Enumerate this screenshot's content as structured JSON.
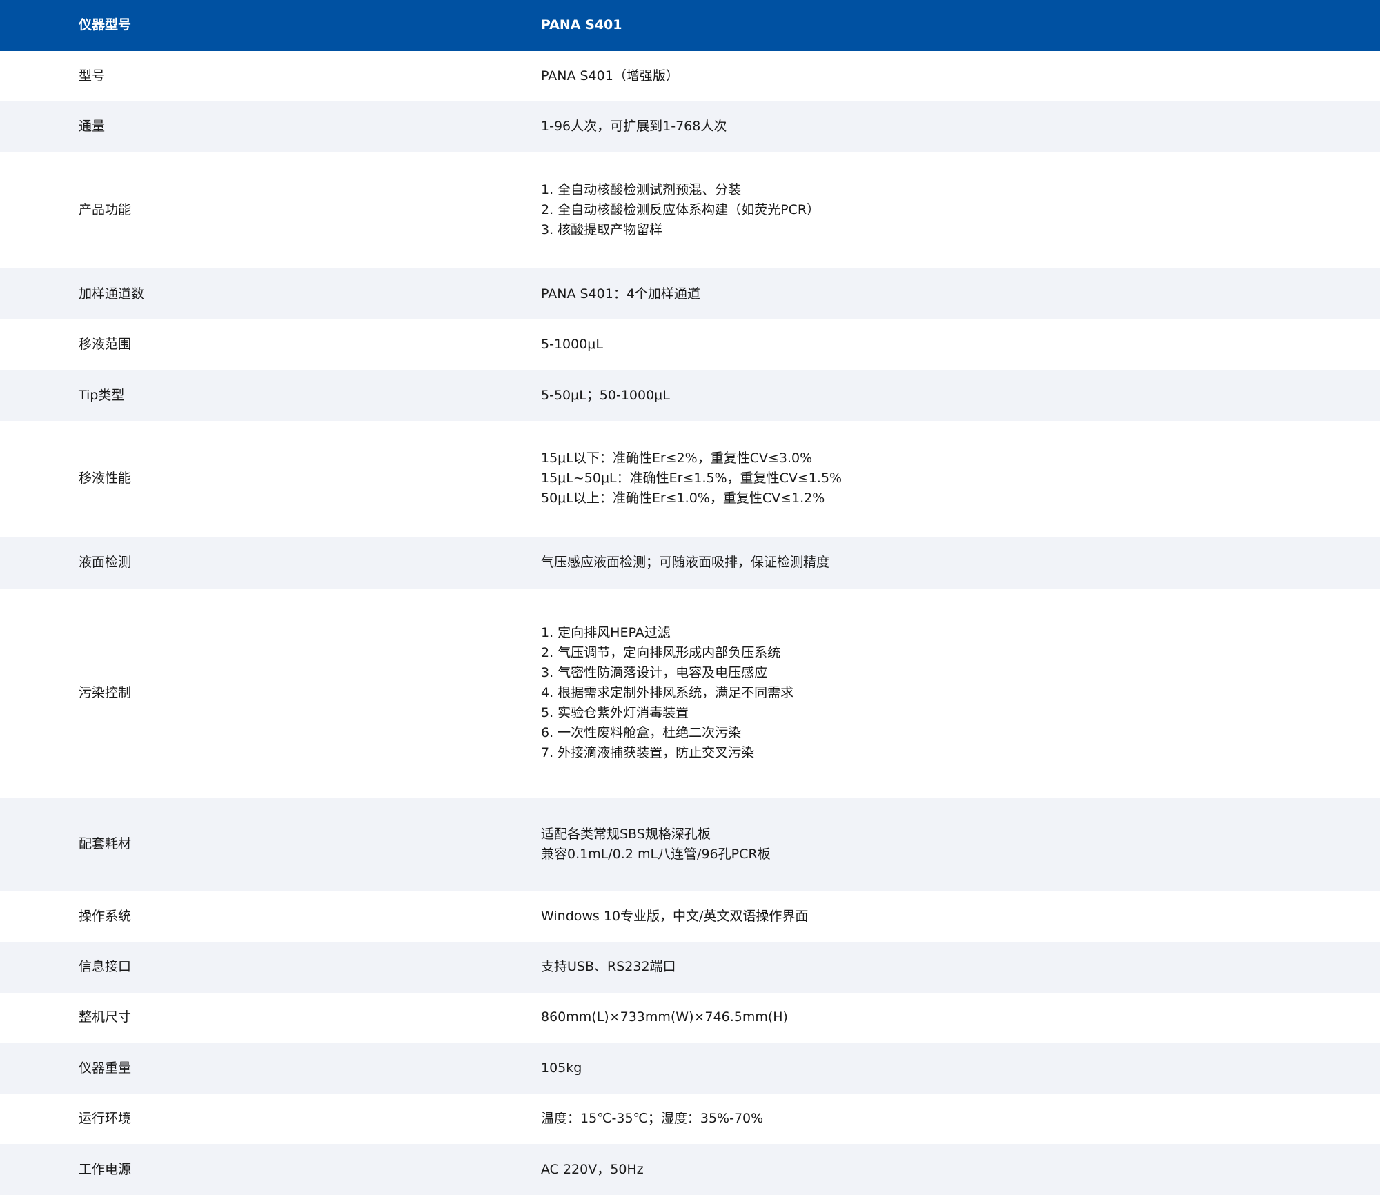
{
  "colors": {
    "header_bg": "#0051a2",
    "header_text": "#ffffff",
    "row_alt_bg": "#f1f3f8",
    "row_bg": "#ffffff",
    "text": "#1a1a1a"
  },
  "header": {
    "label": "仪器型号",
    "value": "PANA S401"
  },
  "rows": [
    {
      "label": "型号",
      "lines": [
        "PANA S401（增强版）"
      ]
    },
    {
      "label": "通量",
      "lines": [
        "1-96人次，可扩展到1-768人次"
      ]
    },
    {
      "label": "产品功能",
      "lines": [
        "1. 全自动核酸检测试剂预混、分装",
        "2. 全自动核酸检测反应体系构建（如荧光PCR）",
        "3. 核酸提取产物留样"
      ]
    },
    {
      "label": "加样通道数",
      "lines": [
        "PANA S401：4个加样通道"
      ]
    },
    {
      "label": "移液范围",
      "lines": [
        "5-1000μL"
      ]
    },
    {
      "label": "Tip类型",
      "lines": [
        "5-50μL；50-1000μL"
      ]
    },
    {
      "label": "移液性能",
      "lines": [
        "15μL以下：准确性Er≤2%，重复性CV≤3.0%",
        "15μL~50μL：准确性Er≤1.5%，重复性CV≤1.5%",
        "50μL以上：准确性Er≤1.0%，重复性CV≤1.2%"
      ]
    },
    {
      "label": "液面检测",
      "lines": [
        "气压感应液面检测；可随液面吸排，保证检测精度"
      ]
    },
    {
      "label": "污染控制",
      "lines": [
        "1. 定向排风HEPA过滤",
        "2. 气压调节，定向排风形成内部负压系统",
        "3. 气密性防滴落设计，电容及电压感应",
        "4. 根据需求定制外排风系统，满足不同需求",
        "5. 实验仓紫外灯消毒装置",
        "6. 一次性废料舱盒，杜绝二次污染",
        "7. 外接滴液捕获装置，防止交叉污染"
      ]
    },
    {
      "label": "配套耗材",
      "lines": [
        "适配各类常规SBS规格深孔板",
        "兼容0.1mL/0.2 mL八连管/96孔PCR板"
      ]
    },
    {
      "label": "操作系统",
      "lines": [
        "Windows 10专业版，中文/英文双语操作界面"
      ]
    },
    {
      "label": "信息接口",
      "lines": [
        "支持USB、RS232端口"
      ]
    },
    {
      "label": "整机尺寸",
      "lines": [
        "860mm(L)×733mm(W)×746.5mm(H)"
      ]
    },
    {
      "label": "仪器重量",
      "lines": [
        "105kg"
      ]
    },
    {
      "label": "运行环境",
      "lines": [
        "温度：15℃-35℃；湿度：35%-70%"
      ]
    },
    {
      "label": "工作电源",
      "lines": [
        "AC 220V，50Hz"
      ]
    }
  ]
}
